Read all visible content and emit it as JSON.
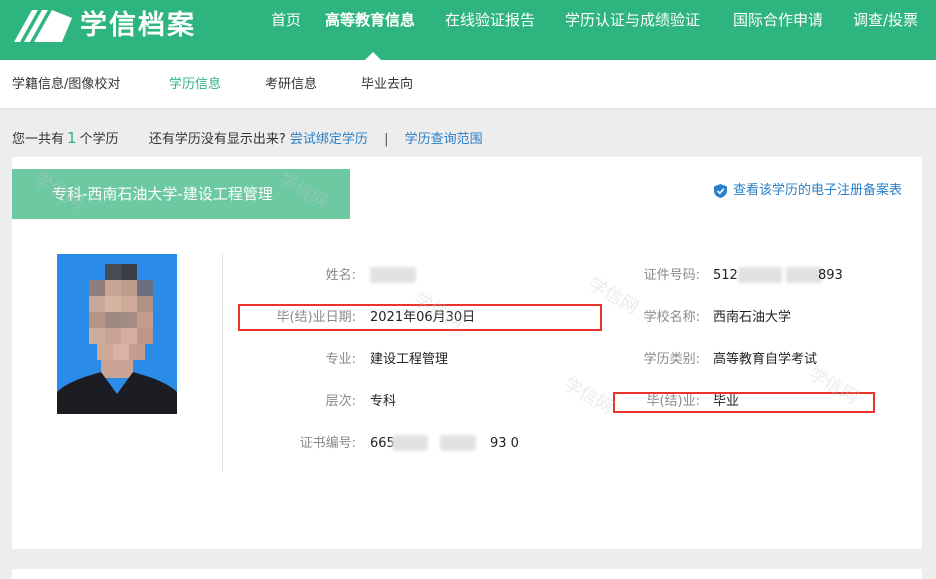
{
  "brand": {
    "logo_text": "学信档案"
  },
  "nav": {
    "items": [
      {
        "label": "首页"
      },
      {
        "label": "高等教育信息"
      },
      {
        "label": "在线验证报告"
      },
      {
        "label": "学历认证与成绩验证"
      },
      {
        "label": "国际合作申请"
      },
      {
        "label": "调查/投票"
      }
    ],
    "active_index": 1
  },
  "subnav": {
    "items": [
      {
        "label": "学籍信息/图像校对"
      },
      {
        "label": "学历信息"
      },
      {
        "label": "考研信息"
      },
      {
        "label": "毕业去向"
      }
    ],
    "active_index": 1
  },
  "summary": {
    "prefix": "您一共有",
    "count": "1",
    "suffix": "个学历",
    "question": "还有学历没有显示出来?",
    "bind_link": "尝试绑定学历",
    "separator": "|",
    "scope_link": "学历查询范围"
  },
  "record": {
    "title": "专科-西南石油大学-建设工程管理",
    "verify_link": "查看该学历的电子注册备案表",
    "fields_left": [
      {
        "label": "姓名:",
        "value": ""
      },
      {
        "label": "毕(结)业日期:",
        "value": "2021年06月30日"
      },
      {
        "label": "专业:",
        "value": "建设工程管理"
      },
      {
        "label": "层次:",
        "value": "专科"
      },
      {
        "label": "证书编号:",
        "value_start": "665",
        "value_end": "93 0"
      }
    ],
    "fields_right": [
      {
        "label": "证件号码:",
        "value_start": "512",
        "value_end": "893"
      },
      {
        "label": "学校名称:",
        "value": "西南石油大学"
      },
      {
        "label": "学历类别:",
        "value": "高等教育自学考试"
      },
      {
        "label": "毕(结)业:",
        "value": "毕业"
      }
    ]
  },
  "colors": {
    "brand_green": "#2eb47f",
    "title_green": "#6cc9a2",
    "link_blue": "#2a7fc9",
    "highlight_red": "#e8342a"
  },
  "watermark_text": "学信网"
}
